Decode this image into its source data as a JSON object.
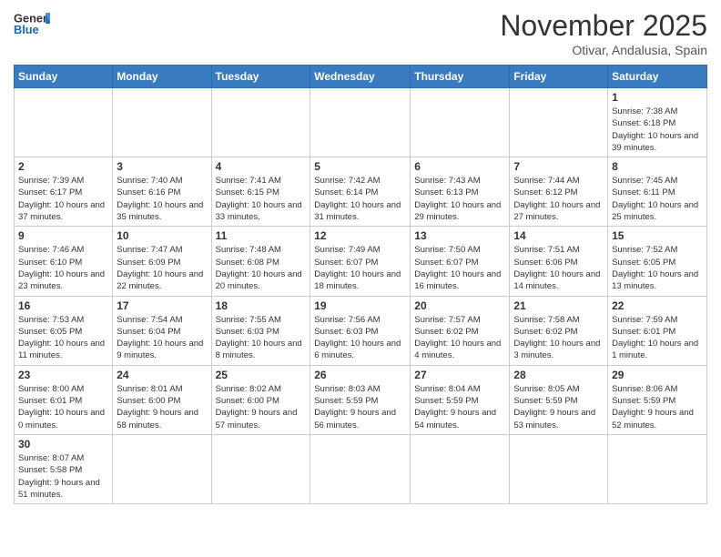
{
  "logo": {
    "text_general": "General",
    "text_blue": "Blue"
  },
  "header": {
    "month": "November 2025",
    "location": "Otivar, Andalusia, Spain"
  },
  "weekdays": [
    "Sunday",
    "Monday",
    "Tuesday",
    "Wednesday",
    "Thursday",
    "Friday",
    "Saturday"
  ],
  "weeks": [
    [
      {
        "day": "",
        "info": ""
      },
      {
        "day": "",
        "info": ""
      },
      {
        "day": "",
        "info": ""
      },
      {
        "day": "",
        "info": ""
      },
      {
        "day": "",
        "info": ""
      },
      {
        "day": "",
        "info": ""
      },
      {
        "day": "1",
        "info": "Sunrise: 7:38 AM\nSunset: 6:18 PM\nDaylight: 10 hours and 39 minutes."
      }
    ],
    [
      {
        "day": "2",
        "info": "Sunrise: 7:39 AM\nSunset: 6:17 PM\nDaylight: 10 hours and 37 minutes."
      },
      {
        "day": "3",
        "info": "Sunrise: 7:40 AM\nSunset: 6:16 PM\nDaylight: 10 hours and 35 minutes."
      },
      {
        "day": "4",
        "info": "Sunrise: 7:41 AM\nSunset: 6:15 PM\nDaylight: 10 hours and 33 minutes."
      },
      {
        "day": "5",
        "info": "Sunrise: 7:42 AM\nSunset: 6:14 PM\nDaylight: 10 hours and 31 minutes."
      },
      {
        "day": "6",
        "info": "Sunrise: 7:43 AM\nSunset: 6:13 PM\nDaylight: 10 hours and 29 minutes."
      },
      {
        "day": "7",
        "info": "Sunrise: 7:44 AM\nSunset: 6:12 PM\nDaylight: 10 hours and 27 minutes."
      },
      {
        "day": "8",
        "info": "Sunrise: 7:45 AM\nSunset: 6:11 PM\nDaylight: 10 hours and 25 minutes."
      }
    ],
    [
      {
        "day": "9",
        "info": "Sunrise: 7:46 AM\nSunset: 6:10 PM\nDaylight: 10 hours and 23 minutes."
      },
      {
        "day": "10",
        "info": "Sunrise: 7:47 AM\nSunset: 6:09 PM\nDaylight: 10 hours and 22 minutes."
      },
      {
        "day": "11",
        "info": "Sunrise: 7:48 AM\nSunset: 6:08 PM\nDaylight: 10 hours and 20 minutes."
      },
      {
        "day": "12",
        "info": "Sunrise: 7:49 AM\nSunset: 6:07 PM\nDaylight: 10 hours and 18 minutes."
      },
      {
        "day": "13",
        "info": "Sunrise: 7:50 AM\nSunset: 6:07 PM\nDaylight: 10 hours and 16 minutes."
      },
      {
        "day": "14",
        "info": "Sunrise: 7:51 AM\nSunset: 6:06 PM\nDaylight: 10 hours and 14 minutes."
      },
      {
        "day": "15",
        "info": "Sunrise: 7:52 AM\nSunset: 6:05 PM\nDaylight: 10 hours and 13 minutes."
      }
    ],
    [
      {
        "day": "16",
        "info": "Sunrise: 7:53 AM\nSunset: 6:05 PM\nDaylight: 10 hours and 11 minutes."
      },
      {
        "day": "17",
        "info": "Sunrise: 7:54 AM\nSunset: 6:04 PM\nDaylight: 10 hours and 9 minutes."
      },
      {
        "day": "18",
        "info": "Sunrise: 7:55 AM\nSunset: 6:03 PM\nDaylight: 10 hours and 8 minutes."
      },
      {
        "day": "19",
        "info": "Sunrise: 7:56 AM\nSunset: 6:03 PM\nDaylight: 10 hours and 6 minutes."
      },
      {
        "day": "20",
        "info": "Sunrise: 7:57 AM\nSunset: 6:02 PM\nDaylight: 10 hours and 4 minutes."
      },
      {
        "day": "21",
        "info": "Sunrise: 7:58 AM\nSunset: 6:02 PM\nDaylight: 10 hours and 3 minutes."
      },
      {
        "day": "22",
        "info": "Sunrise: 7:59 AM\nSunset: 6:01 PM\nDaylight: 10 hours and 1 minute."
      }
    ],
    [
      {
        "day": "23",
        "info": "Sunrise: 8:00 AM\nSunset: 6:01 PM\nDaylight: 10 hours and 0 minutes."
      },
      {
        "day": "24",
        "info": "Sunrise: 8:01 AM\nSunset: 6:00 PM\nDaylight: 9 hours and 58 minutes."
      },
      {
        "day": "25",
        "info": "Sunrise: 8:02 AM\nSunset: 6:00 PM\nDaylight: 9 hours and 57 minutes."
      },
      {
        "day": "26",
        "info": "Sunrise: 8:03 AM\nSunset: 5:59 PM\nDaylight: 9 hours and 56 minutes."
      },
      {
        "day": "27",
        "info": "Sunrise: 8:04 AM\nSunset: 5:59 PM\nDaylight: 9 hours and 54 minutes."
      },
      {
        "day": "28",
        "info": "Sunrise: 8:05 AM\nSunset: 5:59 PM\nDaylight: 9 hours and 53 minutes."
      },
      {
        "day": "29",
        "info": "Sunrise: 8:06 AM\nSunset: 5:59 PM\nDaylight: 9 hours and 52 minutes."
      }
    ],
    [
      {
        "day": "30",
        "info": "Sunrise: 8:07 AM\nSunset: 5:58 PM\nDaylight: 9 hours and 51 minutes."
      },
      {
        "day": "",
        "info": ""
      },
      {
        "day": "",
        "info": ""
      },
      {
        "day": "",
        "info": ""
      },
      {
        "day": "",
        "info": ""
      },
      {
        "day": "",
        "info": ""
      },
      {
        "day": "",
        "info": ""
      }
    ]
  ]
}
